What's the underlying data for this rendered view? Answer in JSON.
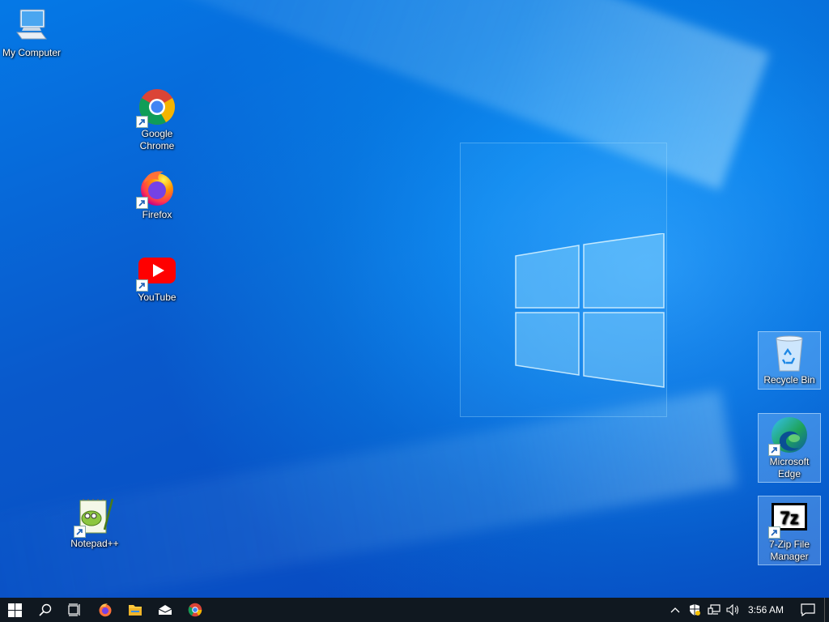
{
  "desktop": {
    "icons": [
      {
        "label": "My Computer",
        "icon": "computer-icon"
      },
      {
        "label": "Google\nChrome",
        "icon": "chrome-icon"
      },
      {
        "label": "Firefox",
        "icon": "firefox-icon"
      },
      {
        "label": "YouTube",
        "icon": "youtube-icon"
      },
      {
        "label": "Notepad++",
        "icon": "notepadpp-icon"
      },
      {
        "label": "Recycle Bin",
        "icon": "recycle-bin-icon"
      },
      {
        "label": "Microsoft\nEdge",
        "icon": "edge-icon"
      },
      {
        "label": "7-Zip File\nManager",
        "icon": "7zip-icon"
      }
    ]
  },
  "taskbar": {
    "start": "windows-start-icon",
    "search": "search-icon",
    "task_view": "task-view-icon",
    "pinned": [
      "firefox-icon",
      "file-explorer-icon",
      "mail-icon",
      "chrome-icon"
    ],
    "tray": [
      "chevron-up-icon",
      "security-shield-icon",
      "network-icon",
      "volume-icon"
    ],
    "clock": "3:56 AM",
    "notification": "action-center-icon"
  },
  "colors": {
    "desktop_bg": "#0a6fd8",
    "taskbar_bg": "#101820"
  }
}
